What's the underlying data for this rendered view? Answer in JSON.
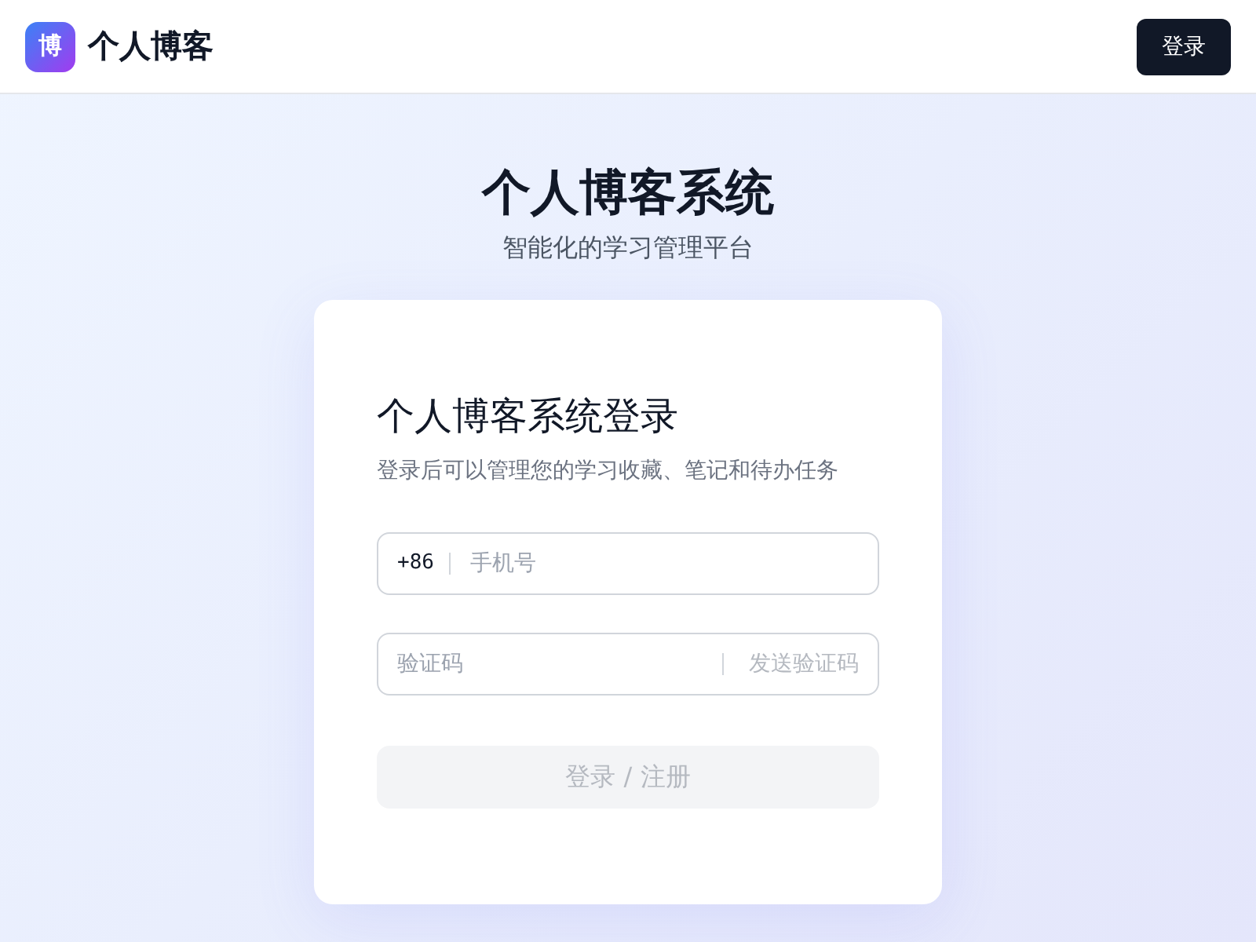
{
  "header": {
    "logo_text": "博",
    "brand": "个人博客",
    "login_button": "登录"
  },
  "hero": {
    "title": "个人博客系统",
    "subtitle": "智能化的学习管理平台"
  },
  "login_card": {
    "title": "个人博客系统登录",
    "description": "登录后可以管理您的学习收藏、笔记和待办任务",
    "phone_field": {
      "prefix": "+86",
      "placeholder": "手机号"
    },
    "code_field": {
      "placeholder": "验证码",
      "send_code_button": {
        "label": "发送验证码",
        "disabled": true
      }
    },
    "submit_button": {
      "label": "登录 / 注册",
      "disabled": true
    }
  }
}
